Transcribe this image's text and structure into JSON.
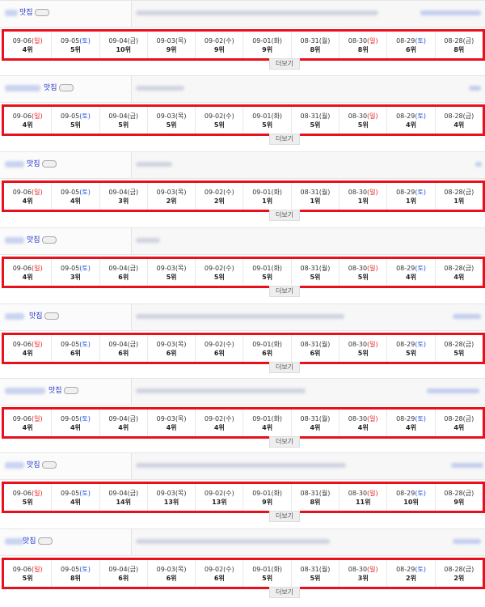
{
  "more_label": "더보기",
  "shop_suffix": "맛집",
  "dates": [
    {
      "date": "09-06",
      "day": "일",
      "type": "sun"
    },
    {
      "date": "09-05",
      "day": "토",
      "type": "sat"
    },
    {
      "date": "09-04",
      "day": "금",
      "type": "wk"
    },
    {
      "date": "09-03",
      "day": "목",
      "type": "wk"
    },
    {
      "date": "09-02",
      "day": "수",
      "type": "wk"
    },
    {
      "date": "09-01",
      "day": "화",
      "type": "wk"
    },
    {
      "date": "08-31",
      "day": "월",
      "type": "wk"
    },
    {
      "date": "08-30",
      "day": "일",
      "type": "sun"
    },
    {
      "date": "08-29",
      "day": "토",
      "type": "sat"
    },
    {
      "date": "08-28",
      "day": "금",
      "type": "wk"
    }
  ],
  "entries": [
    {
      "ranks": [
        "4위",
        "5위",
        "10위",
        "9위",
        "9위",
        "9위",
        "8위",
        "8위",
        "6위",
        "8위"
      ]
    },
    {
      "ranks": [
        "4위",
        "5위",
        "5위",
        "5위",
        "5위",
        "5위",
        "5위",
        "5위",
        "4위",
        "4위"
      ]
    },
    {
      "ranks": [
        "4위",
        "4위",
        "3위",
        "2위",
        "2위",
        "1위",
        "1위",
        "1위",
        "1위",
        "1위"
      ]
    },
    {
      "ranks": [
        "4위",
        "3위",
        "6위",
        "5위",
        "5위",
        "5위",
        "5위",
        "5위",
        "4위",
        "4위"
      ]
    },
    {
      "ranks": [
        "4위",
        "6위",
        "6위",
        "6위",
        "6위",
        "6위",
        "6위",
        "5위",
        "5위",
        "5위"
      ]
    },
    {
      "ranks": [
        "4위",
        "4위",
        "4위",
        "4위",
        "4위",
        "4위",
        "4위",
        "4위",
        "4위",
        "4위"
      ]
    },
    {
      "ranks": [
        "5위",
        "4위",
        "14위",
        "13위",
        "13위",
        "9위",
        "8위",
        "11위",
        "10위",
        "9위"
      ]
    },
    {
      "ranks": [
        "5위",
        "8위",
        "6위",
        "6위",
        "6위",
        "5위",
        "5위",
        "3위",
        "2위",
        "2위"
      ]
    }
  ],
  "colors": {
    "highlight_border": "#e8101d",
    "sunday": "#e41e1e",
    "saturday": "#1a4fd8",
    "shop_link": "#2233cc"
  }
}
